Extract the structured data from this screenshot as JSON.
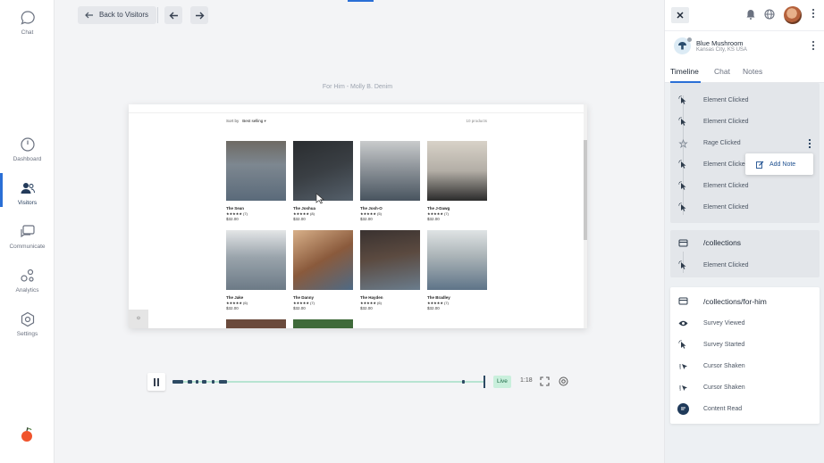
{
  "nav": {
    "chat": "Chat",
    "dashboard": "Dashboard",
    "visitors": "Visitors",
    "communicate": "Communicate",
    "analytics": "Analytics",
    "settings": "Settings"
  },
  "topbar": {
    "back_label": "Back to Visitors"
  },
  "page_caption": "For Him - Molly B. Denim",
  "replay": {
    "sort_label": "Sort by",
    "sort_value": "Best selling",
    "product_count": "10 products",
    "products": [
      {
        "name": "The Sean",
        "stars": "★★★★★ (7)",
        "price": "$32.00",
        "color": "#7d8790"
      },
      {
        "name": "The Joshua",
        "stars": "★★★★★ (8)",
        "price": "$32.00",
        "color": "#3a3f44"
      },
      {
        "name": "The Josh-O",
        "stars": "★★★★★ (5)",
        "price": "$32.00",
        "color": "#8e949a"
      },
      {
        "name": "The J-Dawg",
        "stars": "★★★★★ (7)",
        "price": "$32.00",
        "color": "#b3aea6"
      },
      {
        "name": "The Jake",
        "stars": "★★★★★ (6)",
        "price": "$32.00",
        "color": "#9aa4ac"
      },
      {
        "name": "The Danny",
        "stars": "★★★★★ (7)",
        "price": "$32.00",
        "color": "#8a5a3c"
      },
      {
        "name": "The Hayden",
        "stars": "★★★★★ (6)",
        "price": "$32.00",
        "color": "#5b4a40"
      },
      {
        "name": "The Bradley",
        "stars": "★★★★★ (7)",
        "price": "$32.00",
        "color": "#a9b2b6"
      }
    ],
    "corner_glyph": "⊙"
  },
  "playback": {
    "live_label": "Live",
    "time": "1:18"
  },
  "visitor": {
    "name": "Blue Mushroom",
    "location": "Kansas City, KS USA"
  },
  "tabs": [
    "Timeline",
    "Chat",
    "Notes"
  ],
  "timeline": {
    "group1": [
      "Element Clicked",
      "Element Clicked",
      "Rage Clicked",
      "Element Clicked",
      "Element Clicked",
      "Element Clicked"
    ],
    "add_note": "Add Note",
    "group2_title": "/collections",
    "group2": [
      "Element Clicked"
    ],
    "group3_title": "/collections/for-him",
    "group3": [
      "Survey Viewed",
      "Survey Started",
      "Cursor Shaken",
      "Cursor Shaken",
      "Content Read"
    ]
  },
  "colors": {
    "accent": "#2a6fd6",
    "live_bg": "#c9efdc",
    "track": "#b7e4d2",
    "dark": "#2d4a63"
  }
}
